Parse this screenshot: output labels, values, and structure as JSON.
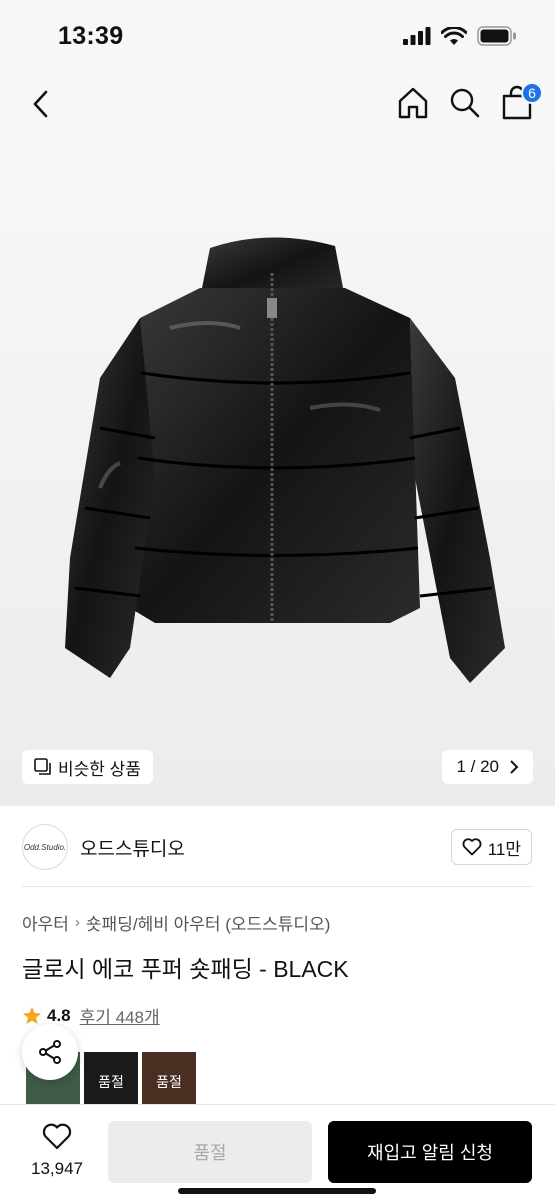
{
  "status_bar": {
    "time": "13:39"
  },
  "nav": {
    "cart_count": "6"
  },
  "hero": {
    "similar_label": "비슷한 상품",
    "page_indicator": "1 / 20"
  },
  "brand": {
    "logo_text": "Odd.Studio.",
    "name": "오드스튜디오",
    "likes": "11만"
  },
  "breadcrumb": [
    "아우터",
    "숏패딩/헤비 아우터 (오드스튜디오)"
  ],
  "product": {
    "title": "글로시 에코 푸퍼 숏패딩 - BLACK",
    "rating": "4.8",
    "reviews": "후기 448개"
  },
  "color_options": [
    {
      "label": "",
      "color": "#3f5a46"
    },
    {
      "label": "품절",
      "color": "#1a1a1a"
    },
    {
      "label": "품절",
      "color": "#4a2e22"
    }
  ],
  "bottom": {
    "wish_count": "13,947",
    "soldout_label": "품절",
    "restock_label": "재입고 알림 신청"
  },
  "colors": {
    "badge": "#1e72e8",
    "star": "#f5a623",
    "primary": "#000000"
  }
}
